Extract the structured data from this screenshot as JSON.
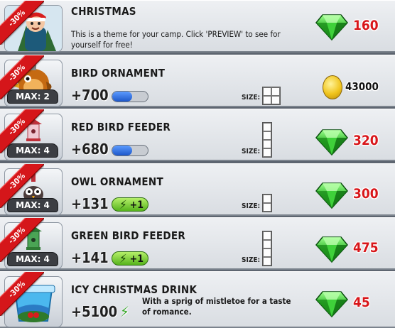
{
  "discount_label": "-30%",
  "items": [
    {
      "title": "CHRISTMAS",
      "description": "This is a theme for your camp. Click 'PREVIEW' to see for yourself for free!",
      "price": "160",
      "currency": "gem-icon"
    },
    {
      "title": "BIRD ORNAMENT",
      "max": "MAX: 2",
      "stat": "+700",
      "bar_fill": 0.55,
      "size_label": "SIZE:",
      "price": "43000",
      "currency": "coin-icon"
    },
    {
      "title": "RED BIRD FEEDER",
      "max": "MAX: 4",
      "stat": "+680",
      "bar_fill": 0.55,
      "size_label": "SIZE:",
      "price": "320",
      "currency": "gem-icon"
    },
    {
      "title": "OWL ORNAMENT",
      "max": "MAX: 4",
      "stat": "+131",
      "energy": "+1",
      "size_label": "SIZE:",
      "price": "300",
      "currency": "gem-icon"
    },
    {
      "title": "GREEN BIRD FEEDER",
      "max": "MAX: 4",
      "stat": "+141",
      "energy": "+1",
      "size_label": "SIZE:",
      "price": "475",
      "currency": "gem-icon"
    },
    {
      "title": "ICY CHRISTMAS DRINK",
      "stat": "+5100",
      "description": "With a sprig of mistletoe for a taste of romance.",
      "price": "45",
      "currency": "gem-icon"
    }
  ],
  "colors": {
    "price_red": "#d8161a",
    "ribbon_red": "#d5161a",
    "gem_green": "#2fb52a",
    "bar_blue": "#2f6fe0",
    "energy_green": "#7dd23a"
  }
}
